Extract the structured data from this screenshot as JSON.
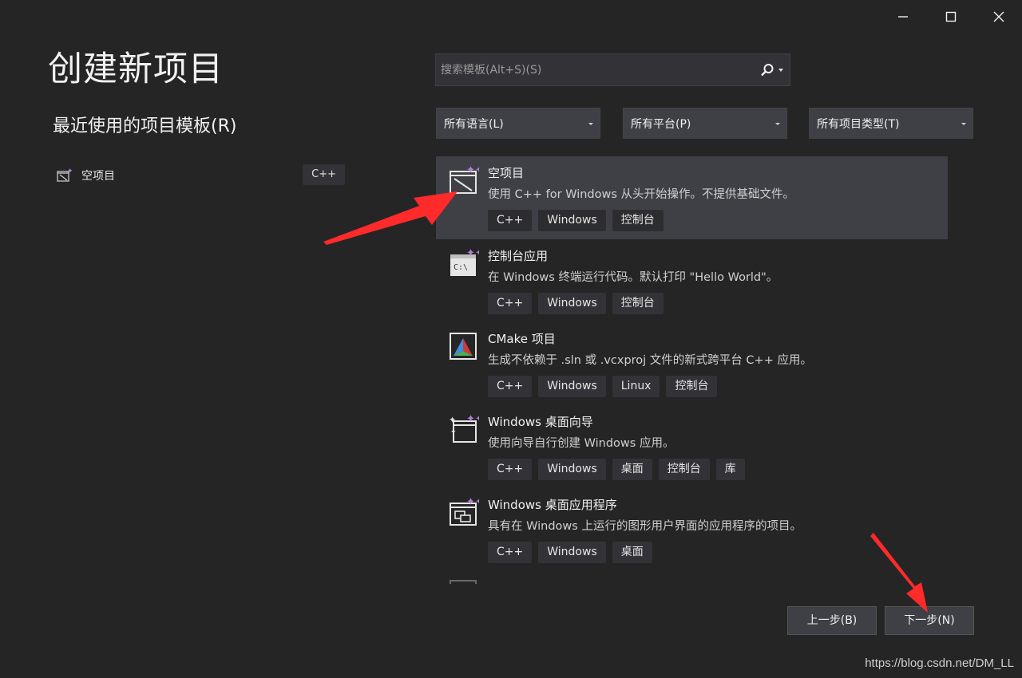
{
  "window": {
    "minimize_icon": "minimize-icon",
    "maximize_icon": "maximize-icon",
    "close_icon": "close-icon"
  },
  "page_title": "创建新项目",
  "recent": {
    "title": "最近使用的项目模板(R)",
    "items": [
      {
        "label": "空项目",
        "tag": "C++",
        "icon": "empty-project-icon"
      }
    ]
  },
  "search": {
    "placeholder": "搜索模板(Alt+S)(S)",
    "icon": "search-icon"
  },
  "filters": {
    "language": "所有语言(L)",
    "platform": "所有平台(P)",
    "project_type": "所有项目类型(T)"
  },
  "templates": [
    {
      "name": "空项目",
      "description": "使用 C++ for Windows 从头开始操作。不提供基础文件。",
      "tags": [
        "C++",
        "Windows",
        "控制台"
      ],
      "icon": "empty-project-icon",
      "selected": true
    },
    {
      "name": "控制台应用",
      "description": "在 Windows 终端运行代码。默认打印 \"Hello World\"。",
      "tags": [
        "C++",
        "Windows",
        "控制台"
      ],
      "icon": "console-app-icon",
      "selected": false
    },
    {
      "name": "CMake 项目",
      "description": "生成不依赖于 .sln 或 .vcxproj 文件的新式跨平台 C++ 应用。",
      "tags": [
        "C++",
        "Windows",
        "Linux",
        "控制台"
      ],
      "icon": "cmake-icon",
      "selected": false
    },
    {
      "name": "Windows 桌面向导",
      "description": "使用向导自行创建 Windows 应用。",
      "tags": [
        "C++",
        "Windows",
        "桌面",
        "控制台",
        "库"
      ],
      "icon": "wizard-icon",
      "selected": false
    },
    {
      "name": "Windows 桌面应用程序",
      "description": "具有在 Windows 上运行的图形用户界面的应用程序的项目。",
      "tags": [
        "C++",
        "Windows",
        "桌面"
      ],
      "icon": "desktop-app-icon",
      "selected": false
    }
  ],
  "buttons": {
    "back": "上一步(B)",
    "next": "下一步(N)"
  },
  "watermark": "https://blog.csdn.net/DM_LL",
  "colors": {
    "background": "#252526",
    "selected": "#3f3f46",
    "tag": "#333337",
    "accent_purple": "#b180d7",
    "annotation_arrow": "#ff2a2a"
  }
}
